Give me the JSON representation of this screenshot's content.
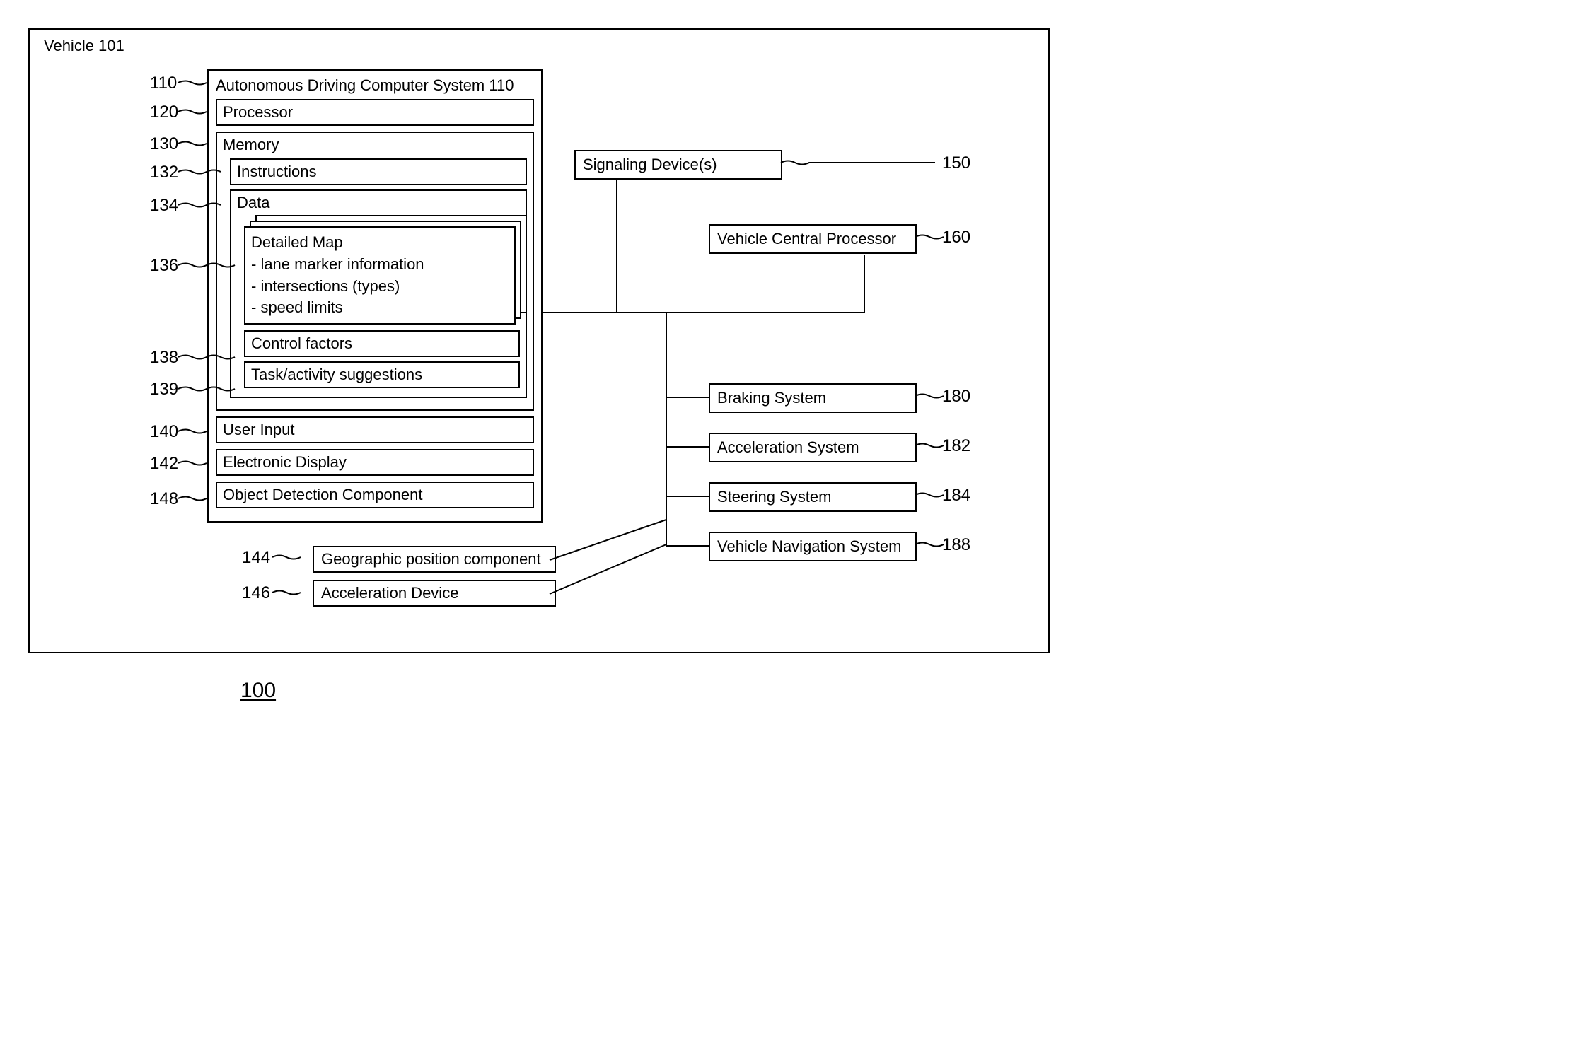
{
  "vehicle_label": "Vehicle 101",
  "main_system": "Autonomous Driving Computer System 110",
  "processor": "Processor",
  "memory": "Memory",
  "instructions": "Instructions",
  "data": "Data",
  "detailed_map": "Detailed Map",
  "map_items": {
    "a": "- lane marker information",
    "b": "- intersections (types)",
    "c": "- speed limits"
  },
  "control_factors": "Control factors",
  "task_activity": "Task/activity suggestions",
  "user_input": "User Input",
  "electronic_display": "Electronic Display",
  "object_detection": "Object Detection Component",
  "geo_position": "Geographic position component",
  "accel_device": "Acceleration Device",
  "signaling": "Signaling Device(s)",
  "central_processor": "Vehicle Central Processor",
  "braking": "Braking System",
  "acceleration_sys": "Acceleration System",
  "steering": "Steering System",
  "navigation": "Vehicle Navigation System",
  "refs": {
    "r110": "110",
    "r120": "120",
    "r130": "130",
    "r132": "132",
    "r134": "134",
    "r136": "136",
    "r138": "138",
    "r139": "139",
    "r140": "140",
    "r142": "142",
    "r148": "148",
    "r144": "144",
    "r146": "146",
    "r150": "150",
    "r160": "160",
    "r180": "180",
    "r182": "182",
    "r184": "184",
    "r188": "188"
  },
  "figure_number": "100"
}
